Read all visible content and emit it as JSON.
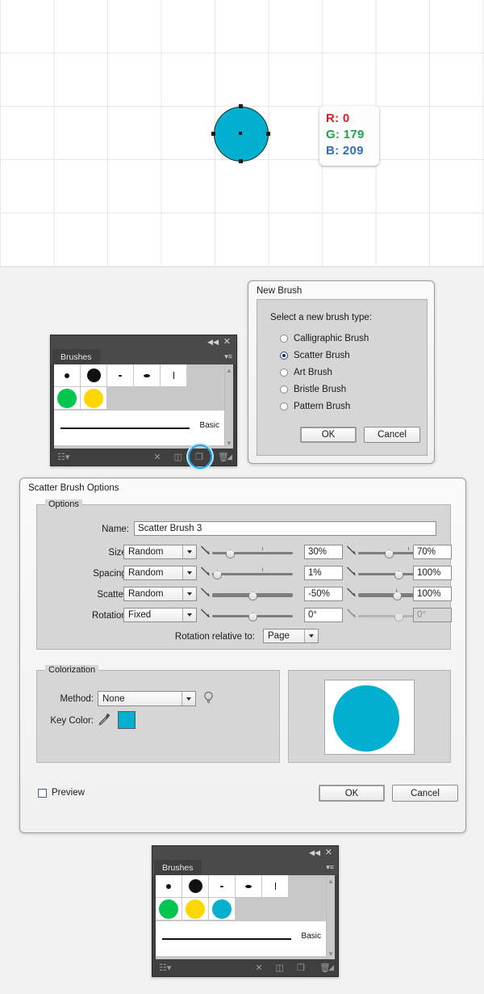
{
  "artboard": {
    "color_tooltip": {
      "r_label": "R: 0",
      "g_label": "G: 179",
      "b_label": "B: 209"
    },
    "shape_fill": "#00b0ce"
  },
  "new_brush_dialog": {
    "title": "New Brush",
    "prompt": "Select a new brush type:",
    "options": [
      {
        "label": "Calligraphic Brush",
        "selected": false
      },
      {
        "label": "Scatter Brush",
        "selected": true
      },
      {
        "label": "Art Brush",
        "selected": false
      },
      {
        "label": "Bristle Brush",
        "selected": false
      },
      {
        "label": "Pattern Brush",
        "selected": false
      }
    ],
    "ok_label": "OK",
    "cancel_label": "Cancel"
  },
  "brushes_panel_top": {
    "tab_label": "Brushes",
    "stroke_label": "Basic",
    "swatches": [
      "#00c64f",
      "#ffd700"
    ],
    "close_icon": "✕",
    "collapse_icon": "◀◀",
    "menu_icon": "▾≡"
  },
  "brushes_panel_bottom": {
    "tab_label": "Brushes",
    "stroke_label": "Basic",
    "swatches": [
      "#00c64f",
      "#ffd700",
      "#00b0ce"
    ],
    "close_icon": "✕",
    "collapse_icon": "◀◀",
    "menu_icon": "▾≡"
  },
  "scatter_brush_options": {
    "title": "Scatter Brush Options",
    "options_legend": "Options",
    "name_label": "Name:",
    "name_value": "Scatter Brush 3",
    "rows": [
      {
        "label": "Size:",
        "mode": "Random",
        "min": "30%",
        "max": "70%",
        "min_pct": 22,
        "max_pct": 35,
        "max_tick_pct": 62,
        "min_tick_pct": 62,
        "disabled": false
      },
      {
        "label": "Spacing:",
        "mode": "Random",
        "min": "1%",
        "max": "100%",
        "min_pct": 4,
        "max_pct": 50,
        "max_tick_pct": 62,
        "min_tick_pct": 62,
        "disabled": false
      },
      {
        "label": "Scatter:",
        "mode": "Random",
        "min": "-50%",
        "max": "100%",
        "min_pct": 50,
        "max_pct": 50,
        "max_tick_pct": 48,
        "min_tick_pct": 0,
        "disabled": false
      },
      {
        "label": "Rotation:",
        "mode": "Fixed",
        "min": "0°",
        "max": "0°",
        "min_pct": 50,
        "max_pct": 50,
        "max_tick_pct": 0,
        "min_tick_pct": 0,
        "disabled": true
      }
    ],
    "rotation_relative_label": "Rotation relative to:",
    "rotation_relative_value": "Page",
    "colorization_legend": "Colorization",
    "method_label": "Method:",
    "method_value": "None",
    "key_color_label": "Key Color:",
    "key_color_value": "#00b0ce",
    "eyedropper_icon": "eyedropper-icon",
    "tip_icon": "lightbulb-icon",
    "preview_label": "Preview",
    "preview_checked": false,
    "ok_label": "OK",
    "cancel_label": "Cancel"
  }
}
